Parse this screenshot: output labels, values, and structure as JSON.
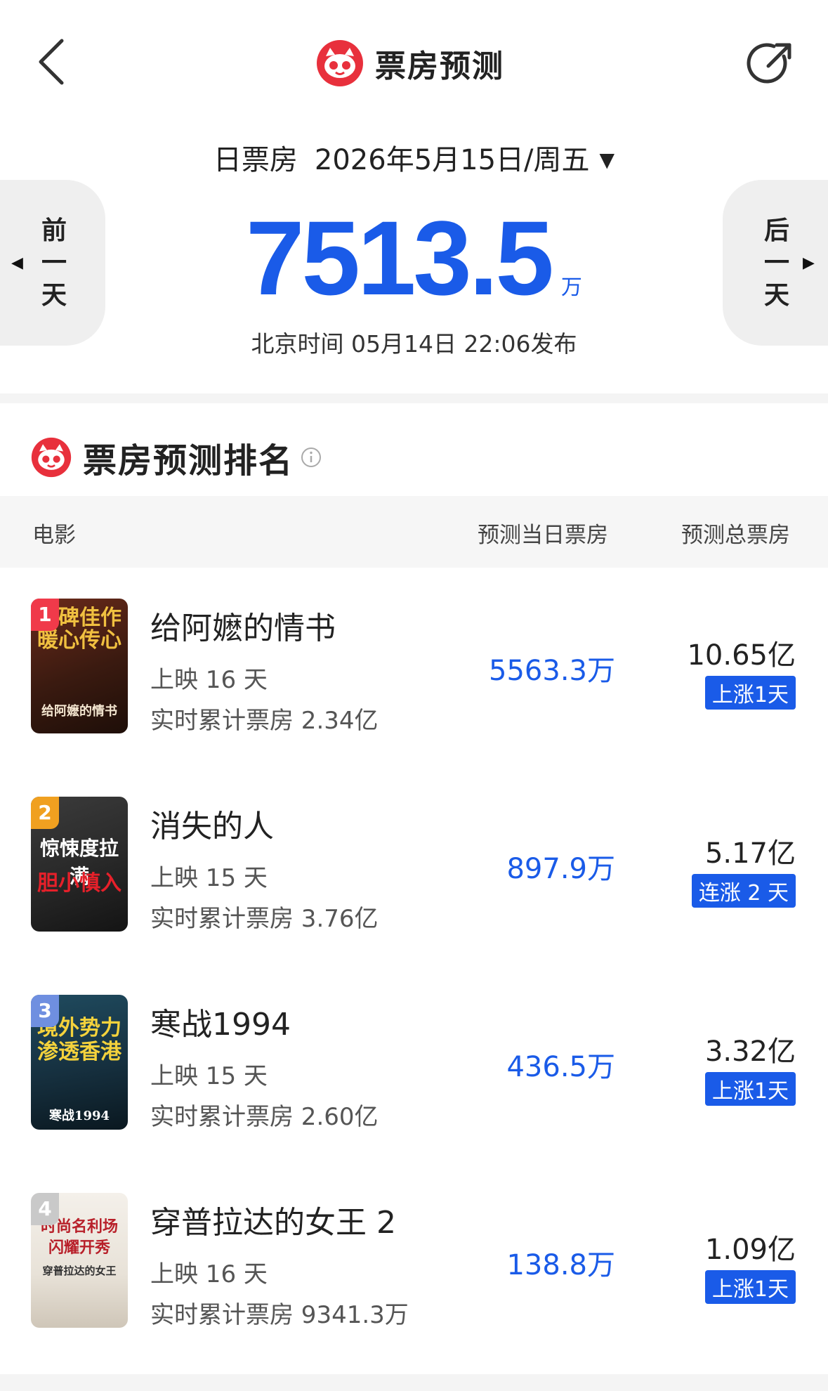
{
  "header": {
    "title": "票房预测",
    "back_icon": "chevron-left-icon",
    "share_icon": "share-icon",
    "logo_icon": "maoyan-cat-logo"
  },
  "date_selector": {
    "label": "日票房",
    "date": "2026年5月15日/周五",
    "caret": "▼"
  },
  "nav": {
    "prev_label": "前一天",
    "prev_chars": [
      "前",
      "一",
      "天"
    ],
    "next_label": "后一天",
    "next_chars": [
      "后",
      "一",
      "天"
    ],
    "prev_arrow": "◀",
    "next_arrow": "▶"
  },
  "summary": {
    "total": "7513.5",
    "unit": "万",
    "publish": "北京时间 05月14日 22:06发布"
  },
  "ranking": {
    "title": "票房预测排名",
    "info_icon": "info-icon",
    "columns": {
      "movie": "电影",
      "day_forecast": "预测当日票房",
      "total_forecast": "预测总票房"
    },
    "rows": [
      {
        "rank": "1",
        "title": "给阿嬷的情书",
        "days": "上映 16 天",
        "cumulative": "实时累计票房 2.34亿",
        "day_box": "5563.3万",
        "total": "10.65亿",
        "trend": "上涨1天",
        "poster_line1": "口碑佳作",
        "poster_line2": "暖心传心",
        "poster_caption": "给阿嬷的情书",
        "rank_color": "#f03a4a"
      },
      {
        "rank": "2",
        "title": "消失的人",
        "days": "上映 15 天",
        "cumulative": "实时累计票房 3.76亿",
        "day_box": "897.9万",
        "total": "5.17亿",
        "trend": "连涨 2 天",
        "poster_line1": "惊悚度拉满",
        "poster_line2": "胆小慎入",
        "poster_caption": "",
        "rank_color": "#f0a020"
      },
      {
        "rank": "3",
        "title": "寒战1994",
        "days": "上映 15 天",
        "cumulative": "实时累计票房 2.60亿",
        "day_box": "436.5万",
        "total": "3.32亿",
        "trend": "上涨1天",
        "poster_line1": "境外势力",
        "poster_line2": "渗透香港",
        "poster_caption": "寒战1994",
        "rank_color": "#6f8fe0"
      },
      {
        "rank": "4",
        "title": "穿普拉达的女王 2",
        "days": "上映 16 天",
        "cumulative": "实时累计票房 9341.3万",
        "day_box": "138.8万",
        "total": "1.09亿",
        "trend": "上涨1天",
        "poster_line1": "时尚名利场",
        "poster_line2": "闪耀开秀",
        "poster_caption": "穿普拉达的女王",
        "rank_color": "#c9c9c9"
      }
    ]
  },
  "colors": {
    "accent": "#1a5be8",
    "brand_red": "#e8303c"
  }
}
